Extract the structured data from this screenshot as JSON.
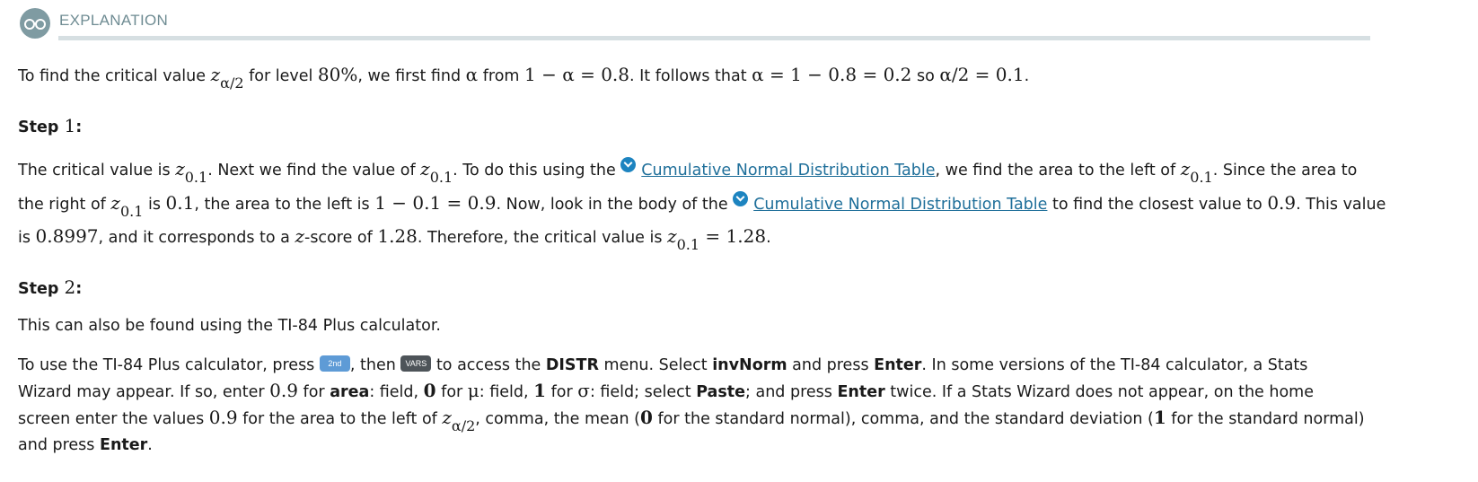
{
  "header": {
    "title": "EXPLANATION"
  },
  "intro": {
    "t1": "To find the critical value ",
    "z": "z",
    "z_sub": "α/2",
    "t2": " for level ",
    "level": "80%",
    "t3": ", we first find ",
    "alpha": "α",
    "t4": " from ",
    "eq1": "1 − α = 0.8",
    "t5": ". It follows that ",
    "eq2": "α = 1 − 0.8 = 0.2",
    "t6": " so ",
    "eq3": "α/2 = 0.1",
    "t7": "."
  },
  "step1": {
    "label": "Step ",
    "num": "1",
    "colon": ":",
    "l1": {
      "a": "The critical value is ",
      "b": ". Next we find the value of ",
      "c": ". To do this using the ",
      "link": "Cumulative Normal Distribution Table",
      "d": ", we find the area to the left of ",
      "e": ". Since the area to"
    },
    "l2": {
      "a": "the right of ",
      "b": " is ",
      "v1": "0.1",
      "c": ", the area to the left is ",
      "eq": "1 − 0.1 = 0.9",
      "d": ". Now, look in the body of the ",
      "link": "Cumulative Normal Distribution Table",
      "e": " to find the closest value to ",
      "v2": "0.9",
      "f": ". This value"
    },
    "l3": {
      "a": "is ",
      "v1": "0.8997",
      "b": ", and it corresponds to a ",
      "z": "z",
      "c": "-score of ",
      "v2": "1.28",
      "d": ". Therefore, the critical value is ",
      "eq": " = 1.28",
      "e": "."
    },
    "z": "z",
    "z_sub": "0.1"
  },
  "step2": {
    "label": "Step ",
    "num": "2",
    "colon": ":",
    "p1": "This can also be found using the TI-84 Plus calculator.",
    "keys": {
      "second": "2nd",
      "vars": "VARS"
    },
    "l1": {
      "a": "To use the TI-84 Plus calculator, press ",
      "b": ", then ",
      "c": " to access the ",
      "distr": "DISTR",
      "d": " menu. Select ",
      "invnorm": "invNorm",
      "e": " and press ",
      "enter": "Enter",
      "f": ". In some versions of the TI-84 calculator, a Stats"
    },
    "l2": {
      "a": "Wizard may appear. If so, enter ",
      "v1": "0.9",
      "b": " for ",
      "area": "area",
      "c": ": field, ",
      "v2": "0",
      "d": " for ",
      "mu": "μ",
      "e": ": field, ",
      "v3": "1",
      "f": " for ",
      "sigma": "σ",
      "g": ": field; select ",
      "paste": "Paste",
      "h": "; and press ",
      "enter": "Enter",
      "i": " twice. If a Stats Wizard does not appear, on the home"
    },
    "l3": {
      "a": "screen enter the values ",
      "v1": "0.9",
      "b": " for the area to the left of ",
      "z": "z",
      "z_sub": "α/2",
      "c": ", comma, the mean (",
      "v2": "0",
      "d": " for the standard normal), comma, and the standard deviation (",
      "v3": "1",
      "e": " for the standard normal)"
    },
    "l4": {
      "a": "and press ",
      "enter": "Enter",
      "b": "."
    }
  }
}
